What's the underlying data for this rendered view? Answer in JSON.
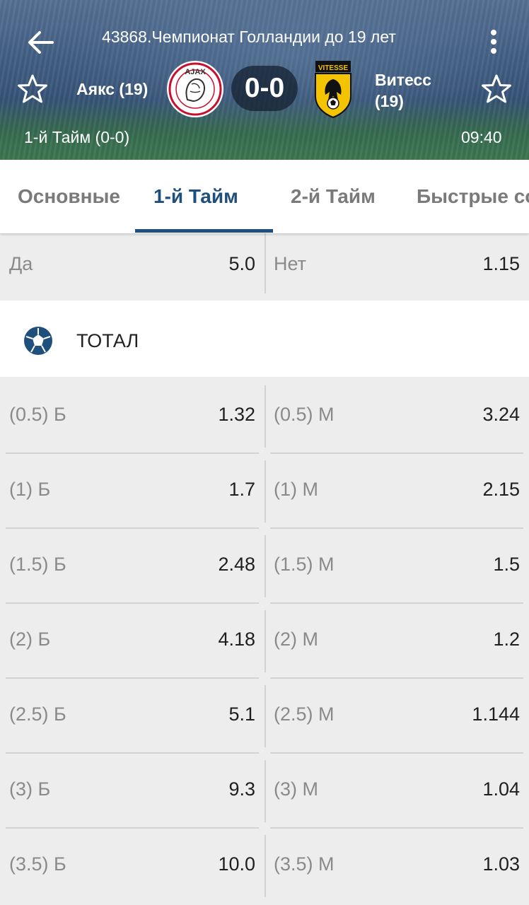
{
  "header": {
    "title": "43868.Чемпионат Голландии до 19 лет",
    "home_team": "Аякс (19)",
    "away_team_line1": "Витесс",
    "away_team_line2": "(19)",
    "score": "0-0",
    "period": "1-й  Тайм (0-0)",
    "clock": "09:40",
    "home_logo_text": "AJAX",
    "away_logo_text": "VITESSE"
  },
  "tabs": [
    {
      "label": "Основные"
    },
    {
      "label": "1-й  Тайм",
      "active": true
    },
    {
      "label": "2-й  Тайм"
    },
    {
      "label": "Быстрые со"
    }
  ],
  "top_market": {
    "left_label": "Да",
    "left_value": "5.0",
    "right_label": "Нет",
    "right_value": "1.15"
  },
  "section": {
    "title": "ТОТАЛ",
    "icon": "soccer-ball-icon"
  },
  "totals": [
    {
      "over_label": "(0.5) Б",
      "over_value": "1.32",
      "under_label": "(0.5) М",
      "under_value": "3.24"
    },
    {
      "over_label": "(1) Б",
      "over_value": "1.7",
      "under_label": "(1) М",
      "under_value": "2.15"
    },
    {
      "over_label": "(1.5) Б",
      "over_value": "2.48",
      "under_label": "(1.5) М",
      "under_value": "1.5"
    },
    {
      "over_label": "(2) Б",
      "over_value": "4.18",
      "under_label": "(2) М",
      "under_value": "1.2"
    },
    {
      "over_label": "(2.5) Б",
      "over_value": "5.1",
      "under_label": "(2.5) М",
      "under_value": "1.144"
    },
    {
      "over_label": "(3) Б",
      "over_value": "9.3",
      "under_label": "(3) М",
      "under_value": "1.04"
    },
    {
      "over_label": "(3.5) Б",
      "over_value": "10.0",
      "under_label": "(3.5) М",
      "under_value": "1.03"
    }
  ],
  "colors": {
    "accent": "#1f4f7d",
    "row_bg": "#ededed",
    "divider": "#d2d2d2"
  }
}
